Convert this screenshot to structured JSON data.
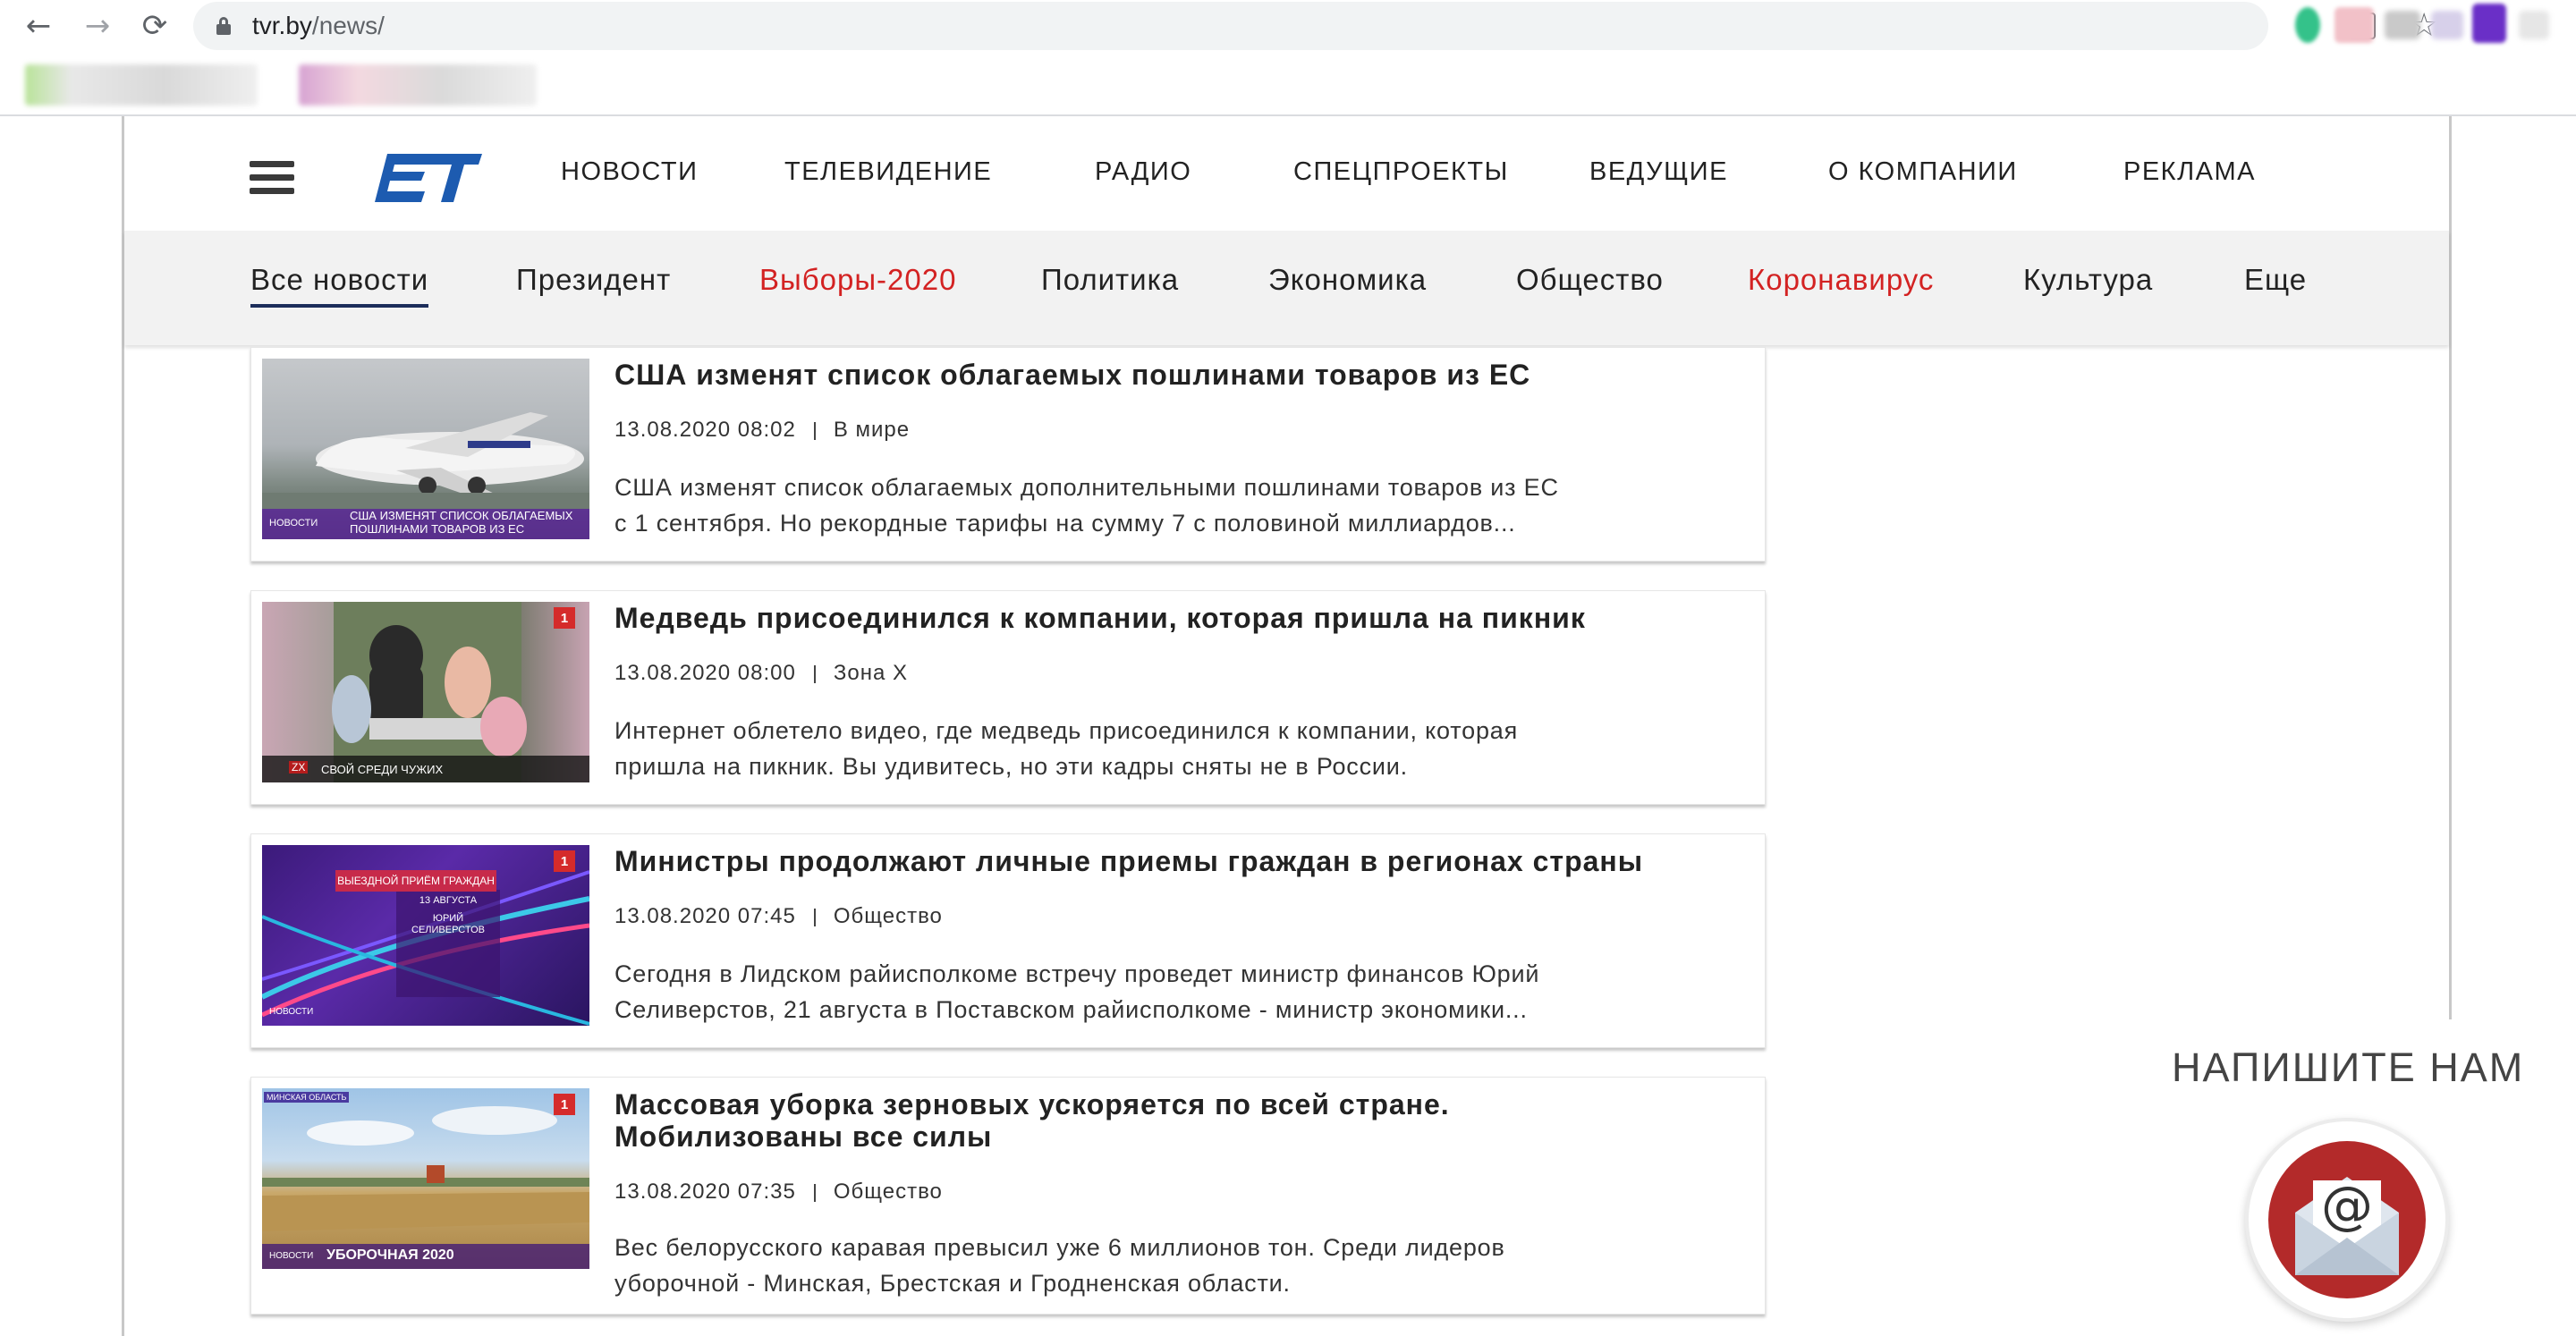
{
  "browser": {
    "back_label": "←",
    "forward_label": "→",
    "reload_label": "⟳",
    "url_host": "tvr.by",
    "url_path": "/news/",
    "translate_label": "G",
    "star_label": "☆"
  },
  "header": {
    "nav": [
      {
        "label": "НОВОСТИ"
      },
      {
        "label": "ТЕЛЕВИДЕНИЕ"
      },
      {
        "label": "РАДИО"
      },
      {
        "label": "СПЕЦПРОЕКТЫ"
      },
      {
        "label": "ВЕДУЩИЕ"
      },
      {
        "label": "О КОМПАНИИ"
      },
      {
        "label": "РЕКЛАМА"
      }
    ]
  },
  "subnav": {
    "items": [
      {
        "label": "Все новости"
      },
      {
        "label": "Президент"
      },
      {
        "label": "Выборы-2020"
      },
      {
        "label": "Политика"
      },
      {
        "label": "Экономика"
      },
      {
        "label": "Общество"
      },
      {
        "label": "Коронавирус"
      },
      {
        "label": "Культура"
      },
      {
        "label": "Еще"
      }
    ],
    "highlight_color": "#d32222"
  },
  "news": [
    {
      "title": "США изменят список облагаемых пошлинами товаров из ЕС",
      "date": "13.08.2020 08:02",
      "category": "В мире",
      "excerpt_1": "США изменят список облагаемых дополнительными пошлинами товаров из ЕС",
      "excerpt_2": "с 1 сентября. Но рекордные тарифы на сумму 7 с половиной миллиардов...",
      "thumb_caption_1": "США ИЗМЕНЯТ СПИСОК ОБЛАГАЕМЫХ",
      "thumb_caption_2": "ПОШЛИНАМИ ТОВАРОВ ИЗ ЕС",
      "thumb_tag": "НОВОСТИ"
    },
    {
      "title": "Медведь присоединился к компании, которая пришла на пикник",
      "date": "13.08.2020 08:00",
      "category": "Зона Х",
      "excerpt_1": "Интернет облетело видео, где медведь присоединился к компании, которая",
      "excerpt_2": "пришла на пикник. Вы удивитесь, но эти кадры сняты не в России.",
      "thumb_caption_1": "СВОЙ СРЕДИ ЧУЖИХ",
      "thumb_badge": "1",
      "thumb_tag": "ZX"
    },
    {
      "title": "Министры продолжают личные приемы граждан в регионах страны",
      "date": "13.08.2020 07:45",
      "category": "Общество",
      "excerpt_1": "Сегодня в Лидском райисполкоме встречу проведет министр финансов Юрий",
      "excerpt_2": "Селиверстов, 21 августа в Поставском райисполкоме - министр экономики...",
      "thumb_caption_1": "ВЫЕЗДНОЙ ПРИЁМ ГРАЖДАН",
      "thumb_caption_2": "13 АВГУСТА",
      "thumb_caption_3": "ЮРИЙ СЕЛИВЕРСТОВ",
      "thumb_badge": "1",
      "thumb_tag": "НОВОСТИ"
    },
    {
      "title_1": "Массовая уборка зерновых ускоряется по всей стране.",
      "title_2": "Мобилизованы все силы",
      "date": "13.08.2020 07:35",
      "category": "Общество",
      "excerpt_1": "Вес белорусского каравая превысил уже 6 миллионов тон. Среди лидеров",
      "excerpt_2": "уборочной - Минская, Брестская и Гродненская области.",
      "thumb_caption_1": "УБОРОЧНАЯ 2020",
      "thumb_badge": "1",
      "thumb_tag": "НОВОСТИ",
      "thumb_region": "МИНСКАЯ ОБЛАСТЬ"
    }
  ],
  "write_us": {
    "label": "НАПИШИТЕ НАМ",
    "icon_symbol": "@"
  },
  "colors": {
    "accent_red": "#d32222",
    "active_underline": "#1c2d5a",
    "logo_blue": "#1d5bb0"
  }
}
